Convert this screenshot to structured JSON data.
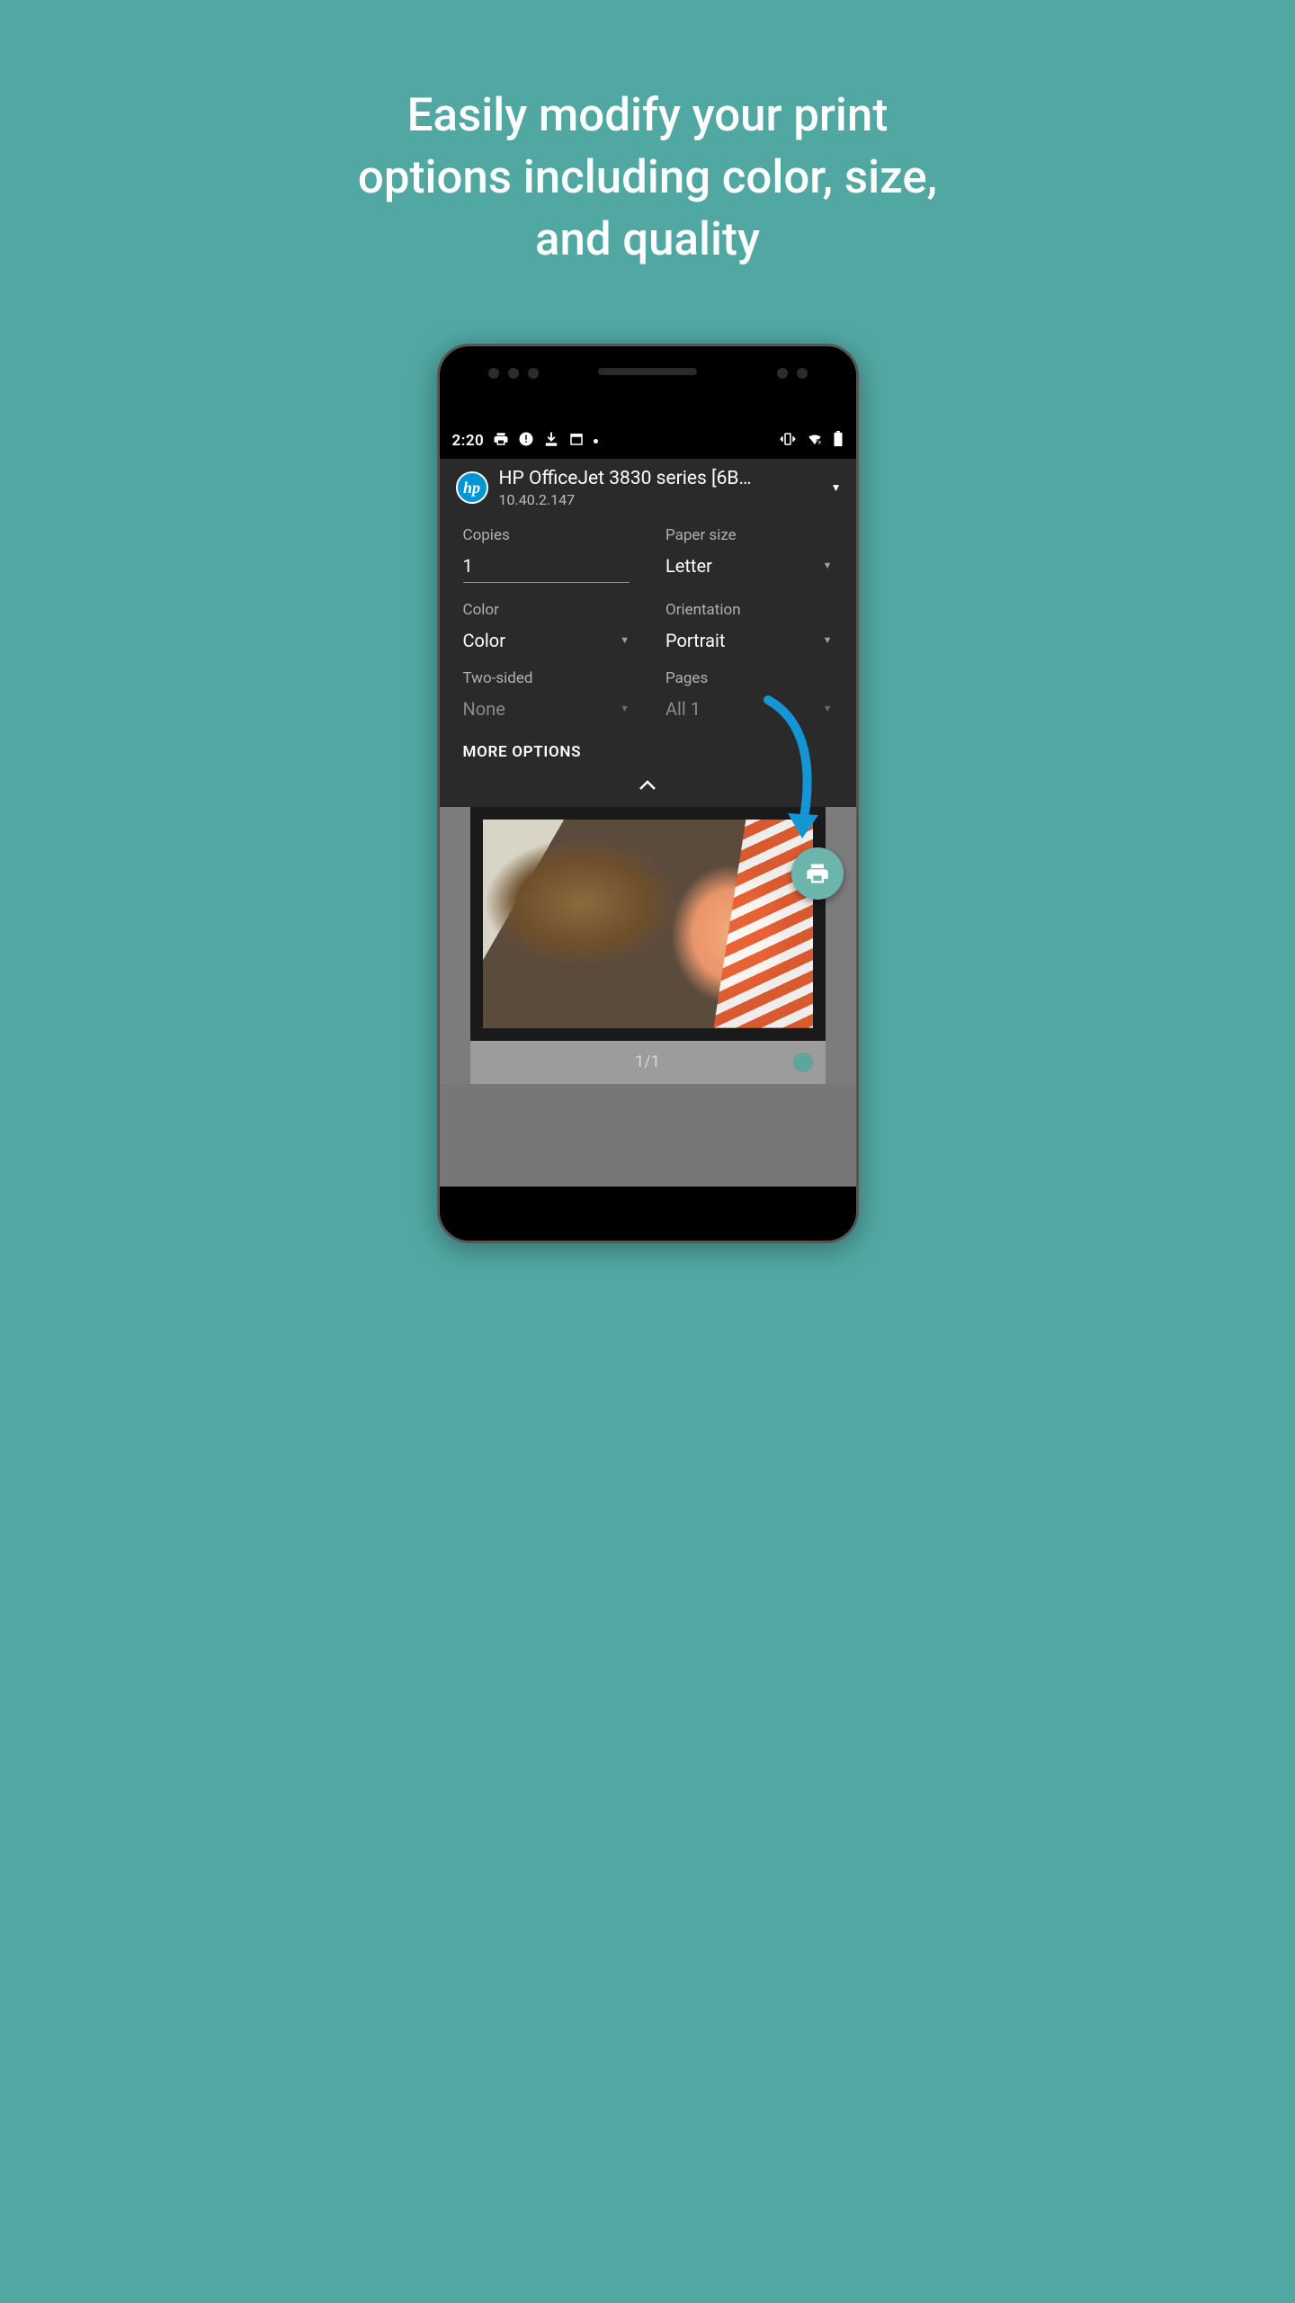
{
  "headline": "Easily modify your print options including color, size, and quality",
  "statusbar": {
    "time": "2:20"
  },
  "printer": {
    "name": "HP OfficeJet 3830 series [6B…",
    "ip": "10.40.2.147",
    "logo_text": "hp"
  },
  "options": {
    "copies": {
      "label": "Copies",
      "value": "1"
    },
    "paper_size": {
      "label": "Paper size",
      "value": "Letter"
    },
    "color": {
      "label": "Color",
      "value": "Color"
    },
    "orientation": {
      "label": "Orientation",
      "value": "Portrait"
    },
    "two_sided": {
      "label": "Two-sided",
      "value": "None"
    },
    "pages": {
      "label": "Pages",
      "value": "All 1"
    }
  },
  "more_options": "MORE OPTIONS",
  "preview": {
    "page_indicator": "1/1"
  }
}
